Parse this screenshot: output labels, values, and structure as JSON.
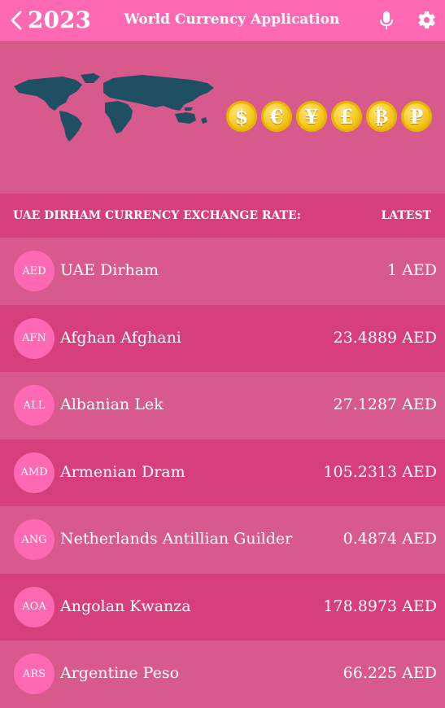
{
  "topbar": {
    "year": "2023",
    "title": "World Currency Application",
    "icons": [
      "back-chevron-icon",
      "microphone-icon",
      "gear-icon"
    ]
  },
  "banner": {
    "coins": [
      "$",
      "€",
      "¥",
      "£",
      "₿",
      "₽"
    ]
  },
  "header": {
    "label": "UAE DIRHAM CURRENCY EXCHANGE RATE:",
    "latest": "LATEST"
  },
  "currencies": [
    {
      "code": "AED",
      "name": "UAE Dirham",
      "value": "1 AED"
    },
    {
      "code": "AFN",
      "name": "Afghan Afghani",
      "value": "23.4889 AED"
    },
    {
      "code": "ALL",
      "name": "Albanian Lek",
      "value": "27.1287 AED"
    },
    {
      "code": "AMD",
      "name": "Armenian Dram",
      "value": "105.2313 AED"
    },
    {
      "code": "ANG",
      "name": "Netherlands Antillian Guilder",
      "value": "0.4874 AED"
    },
    {
      "code": "AOA",
      "name": "Angolan Kwanza",
      "value": "178.8973 AED"
    },
    {
      "code": "ARS",
      "name": "Argentine Peso",
      "value": "66.225 AED"
    }
  ],
  "colors": {
    "topbar": "#ff69b4",
    "banner": "#d85a8c",
    "row_dark": "#d63f7c",
    "badge": "#ff69b4",
    "map": "#1f4f63",
    "coin": "#f5c518"
  }
}
